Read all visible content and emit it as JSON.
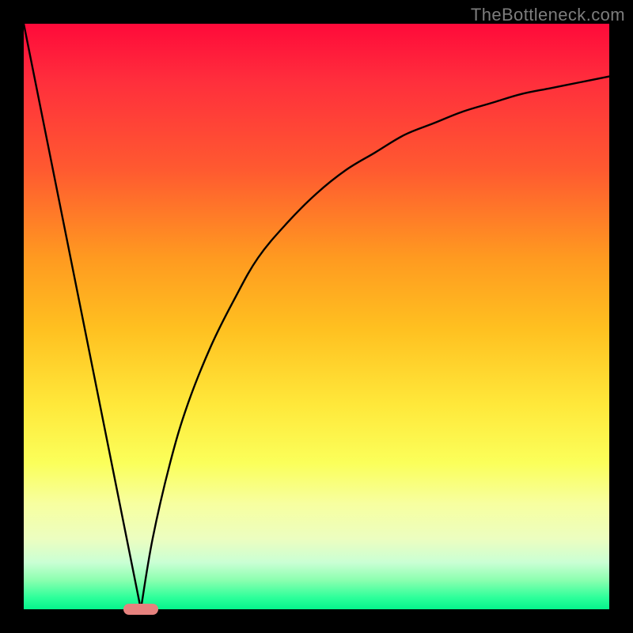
{
  "watermark": {
    "text": "TheBottleneck.com"
  },
  "chart_data": {
    "type": "line",
    "title": "",
    "xlabel": "",
    "ylabel": "",
    "xlim": [
      0,
      100
    ],
    "ylim": [
      0,
      100
    ],
    "grid": false,
    "legend": null,
    "background_gradient": {
      "orientation": "vertical",
      "stops": [
        {
          "pos": 0.0,
          "color": "#ff0a3a"
        },
        {
          "pos": 0.5,
          "color": "#ffc020"
        },
        {
          "pos": 0.8,
          "color": "#fbff5a"
        },
        {
          "pos": 1.0,
          "color": "#05f38c"
        }
      ]
    },
    "series": [
      {
        "name": "left-branch",
        "x": [
          0,
          2,
          4,
          6,
          8,
          10,
          12,
          14,
          16,
          18,
          19,
          20
        ],
        "values": [
          100,
          90,
          80,
          70,
          60,
          50,
          40,
          30,
          20,
          10,
          5,
          0
        ]
      },
      {
        "name": "right-branch",
        "x": [
          20,
          22,
          25,
          28,
          32,
          36,
          40,
          45,
          50,
          55,
          60,
          65,
          70,
          75,
          80,
          85,
          90,
          95,
          100
        ],
        "values": [
          0,
          12,
          25,
          35,
          45,
          53,
          60,
          66,
          71,
          75,
          78,
          81,
          83,
          85,
          86.5,
          88,
          89,
          90,
          91
        ]
      }
    ],
    "marker": {
      "x": 20,
      "y": 0,
      "color": "#e6827e",
      "shape": "pill"
    },
    "notes": "y axis: 0 = bottom (green), 100 = top (red). Minimum of curve at x≈20."
  }
}
